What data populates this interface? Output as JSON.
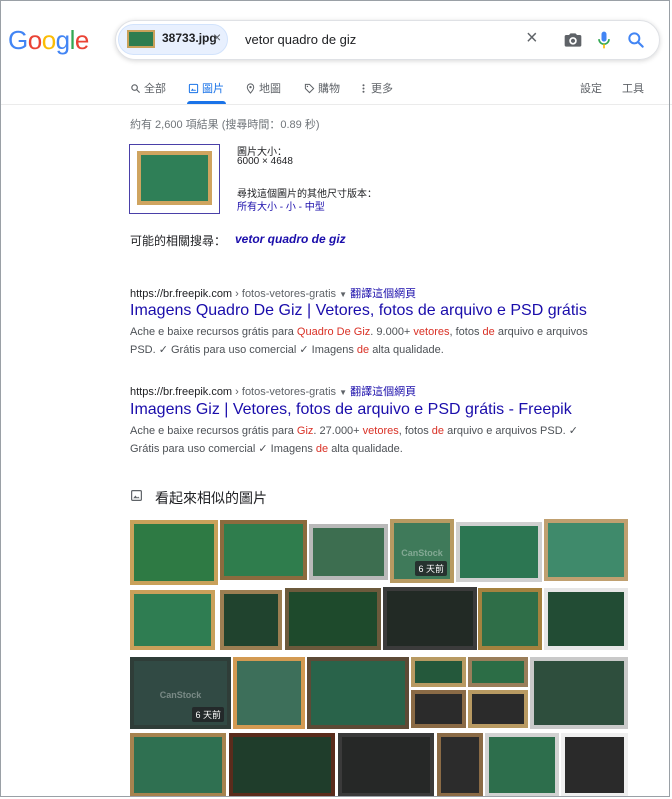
{
  "header": {
    "logo_letters": [
      {
        "ch": "G",
        "color": "#4285F4"
      },
      {
        "ch": "o",
        "color": "#EA4335"
      },
      {
        "ch": "o",
        "color": "#FBBC05"
      },
      {
        "ch": "g",
        "color": "#4285F4"
      },
      {
        "ch": "l",
        "color": "#34A853"
      },
      {
        "ch": "e",
        "color": "#EA4335"
      }
    ],
    "image_chip": {
      "filename": "38733.jpg",
      "remove": "×"
    },
    "query": "vetor quadro de giz",
    "clear": "×",
    "icons": [
      "camera-icon",
      "microphone-icon",
      "search-icon"
    ]
  },
  "tabs": {
    "items": [
      {
        "label": "全部",
        "icon": "search-icon",
        "active": false
      },
      {
        "label": "圖片",
        "icon": "image-icon",
        "active": true
      },
      {
        "label": "地圖",
        "icon": "map-pin-icon",
        "active": false
      },
      {
        "label": "購物",
        "icon": "tag-icon",
        "active": false
      },
      {
        "label": "更多",
        "icon": "more-vert-icon",
        "active": false
      }
    ],
    "settings": "設定",
    "tools": "工具"
  },
  "stats": "約有 2,600 項結果 (搜尋時間：0.89 秒)",
  "image_info": {
    "size_label": "圖片大小：",
    "size_value": "6000 × 4648",
    "other_sizes_label": "尋找這個圖片的其他尺寸版本：",
    "size_links": [
      "所有大小",
      "小",
      "中型"
    ],
    "separator": " - "
  },
  "related": {
    "label": "可能的相關搜尋：",
    "query": "vetor quadro de giz"
  },
  "results": [
    {
      "domain": "https://br.freepik.com",
      "path": " › fotos-vetores-gratis",
      "translate": "翻譯這個網頁",
      "title": "Imagens Quadro De Giz | Vetores, fotos de arquivo e PSD grátis",
      "snippet_parts": [
        {
          "t": "Ache e baixe recursos grátis para ",
          "hl": false
        },
        {
          "t": "Quadro De Giz",
          "hl": true
        },
        {
          "t": ". 9.000+ ",
          "hl": false
        },
        {
          "t": "vetores",
          "hl": true
        },
        {
          "t": ", fotos ",
          "hl": false
        },
        {
          "t": "de",
          "hl": true
        },
        {
          "t": " arquivo e arquivos PSD. ✓ Grátis para uso comercial ✓ Imagens ",
          "hl": false
        },
        {
          "t": "de",
          "hl": true
        },
        {
          "t": " alta qualidade.",
          "hl": false
        }
      ]
    },
    {
      "domain": "https://br.freepik.com",
      "path": " › fotos-vetores-gratis",
      "translate": "翻譯這個網頁",
      "title": "Imagens Giz | Vetores, fotos de arquivo e PSD grátis - Freepik",
      "snippet_parts": [
        {
          "t": "Ache e baixe recursos grátis para ",
          "hl": false
        },
        {
          "t": "Giz",
          "hl": true
        },
        {
          "t": ". 27.000+ ",
          "hl": false
        },
        {
          "t": "vetores",
          "hl": true
        },
        {
          "t": ", fotos ",
          "hl": false
        },
        {
          "t": "de",
          "hl": true
        },
        {
          "t": " arquivo e arquivos PSD. ✓ Grátis para uso comercial ✓ Imagens ",
          "hl": false
        },
        {
          "t": "de",
          "hl": true
        },
        {
          "t": " alta qualidade.",
          "hl": false
        }
      ]
    }
  ],
  "similar": {
    "title": "看起來相似的圖片",
    "icon": "image-icon",
    "badges": [
      "6 天前",
      "6 天前"
    ],
    "watermark": "CanStock"
  },
  "colors": {
    "link": "#1a0dab",
    "highlight": "#d93025",
    "accent": "#1a73e8",
    "chalkboard_green": "#2e7d4f",
    "wood_frame": "#c9a15a"
  }
}
